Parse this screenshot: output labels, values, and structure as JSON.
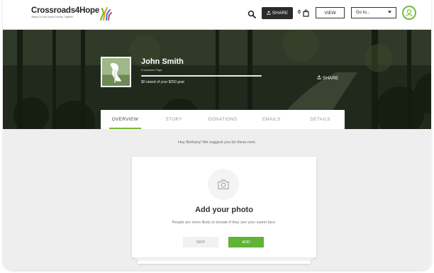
{
  "header": {
    "logo_text": "Crossroads4Hope",
    "logo_tagline": "Taking On Your Cancer Journey, Together.",
    "share_label": "SHARE",
    "cart_count": "0",
    "view_label": "VIEW",
    "goto_label": "Go to...",
    "icons": [
      "search-icon",
      "share-icon",
      "cart-icon",
      "chevron-down-icon",
      "user-avatar-icon"
    ]
  },
  "hero": {
    "name": "John Smith",
    "subtitle": "Fundraiser Page",
    "raised_text": "$0 raised of your $250 goal",
    "progress": 0,
    "share_label": "SHARE"
  },
  "tabs": [
    {
      "label": "OVERVIEW",
      "active": true
    },
    {
      "label": "STORY",
      "active": false
    },
    {
      "label": "DONATIONS",
      "active": false
    },
    {
      "label": "EMAILS",
      "active": false
    },
    {
      "label": "DETAILS",
      "active": false
    }
  ],
  "main": {
    "suggestion": "Hey Bethany! We suggest you do these next.",
    "card": {
      "title": "Add your photo",
      "description": "People are more likely to donate if they see your sweet face.",
      "skip_label": "SKIP",
      "add_label": "ADD"
    }
  },
  "colors": {
    "accent_green": "#5fb336",
    "dark_button": "#2b2b2b",
    "page_bg": "#eeeeef"
  }
}
